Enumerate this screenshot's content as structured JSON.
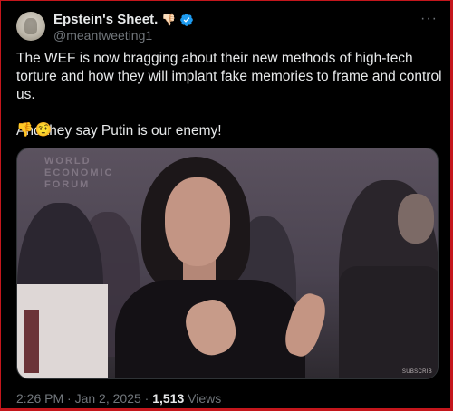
{
  "author": {
    "display_name": "Epstein's Sheet.",
    "name_emoji": "👎🏻",
    "handle": "@meantweeting1",
    "verified": true
  },
  "tweet": {
    "line1": "The WEF is now bragging about their new methods of high-tech torture and how they will implant fake memories to frame and control us.",
    "line2": "And they say Putin is our enemy!",
    "emojis": "👎🤨"
  },
  "media": {
    "logo_text_1": "WORLD",
    "logo_text_2": "ECONOMIC",
    "logo_text_3": "FORUM",
    "watermark": "SUBSCRIB"
  },
  "meta": {
    "time": "2:26 PM",
    "separator": "·",
    "date": "Jan 2, 2025",
    "views_count": "1,513",
    "views_label": "Views"
  },
  "more_icon": "···",
  "colors": {
    "background": "#000000",
    "text": "#e7e9ea",
    "muted": "#71767b",
    "verified": "#1d9bf0",
    "frame": "#c4161c"
  }
}
